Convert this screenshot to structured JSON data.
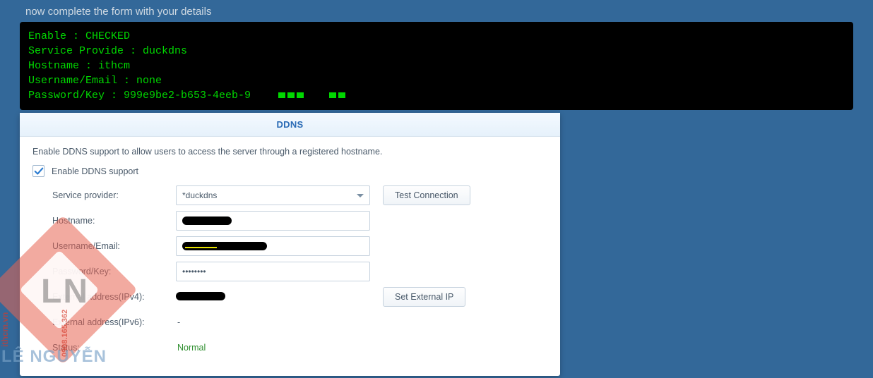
{
  "header": {
    "instruction": "now complete the form with your details"
  },
  "terminal": {
    "lines": [
      "Enable : CHECKED",
      "Service Provide : duckdns",
      "Hostname : ithcm",
      "Username/Email : none",
      "Password/Key : 999e9be2-b653-4eeb-9"
    ]
  },
  "panel": {
    "title": "DDNS",
    "description": "Enable DDNS support to allow users to access the server through a registered hostname.",
    "enable_label": "Enable DDNS support",
    "enable_checked": true,
    "fields": {
      "service_provider": {
        "label": "Service provider:",
        "value": "*duckdns"
      },
      "hostname": {
        "label": "Hostname:"
      },
      "username": {
        "label": "Username/Email:"
      },
      "password": {
        "label": "Password/Key:",
        "value": "••••••••"
      },
      "ext_ipv4": {
        "label": "External address(IPv4):"
      },
      "ext_ipv6": {
        "label": "External address(IPv6):",
        "value": "-"
      },
      "status": {
        "label": "Status:",
        "value": "Normal"
      }
    },
    "buttons": {
      "test_connection": "Test Connection",
      "set_external_ip": "Set External IP"
    }
  },
  "watermark": {
    "initials": "LN",
    "site": "ithcm.vn",
    "phone": "0908.165.362",
    "name": "LÊ NGUYỄN"
  }
}
